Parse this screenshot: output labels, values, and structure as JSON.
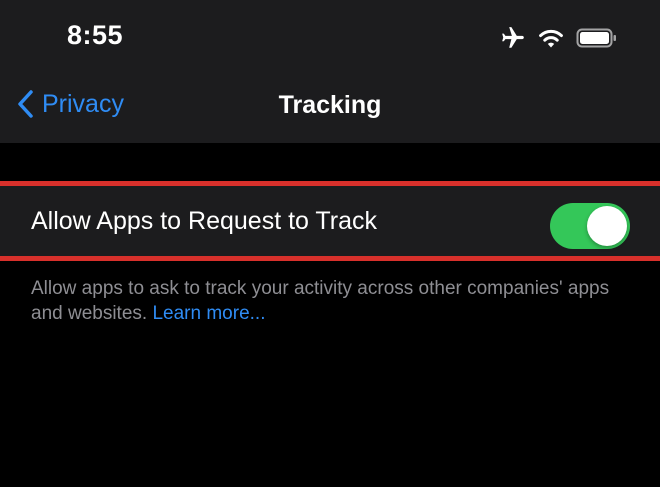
{
  "status_bar": {
    "time": "8:55",
    "icons": [
      "airplane-icon",
      "wifi-icon",
      "battery-icon"
    ]
  },
  "nav": {
    "back_label": "Privacy",
    "title": "Tracking"
  },
  "setting": {
    "label": "Allow Apps to Request to Track",
    "toggle_on": true
  },
  "footer": {
    "description": "Allow apps to ask to track your activity across other companies' apps and websites.",
    "link_label": "Learn more..."
  },
  "colors": {
    "background": "#000000",
    "panel": "#1c1c1e",
    "accent_blue": "#2f8cf4",
    "toggle_green": "#34c759",
    "highlight_red": "#d8302b",
    "secondary_text": "#8e8e93"
  }
}
